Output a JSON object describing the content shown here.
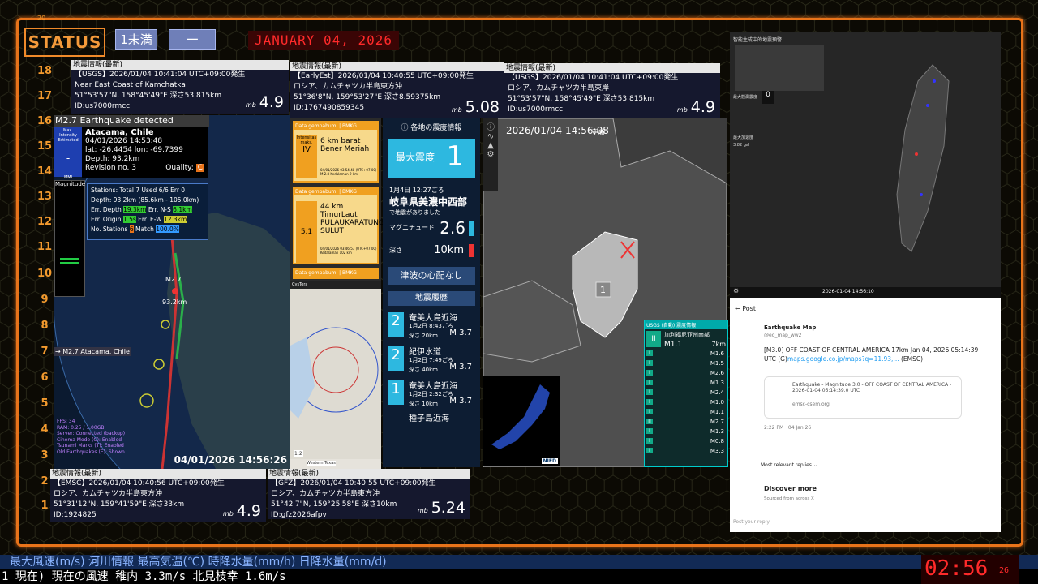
{
  "header": {
    "status_label": "STATUS",
    "tag1": "1未満",
    "tag2": "一",
    "date_led": "JANUARY 04, 2026",
    "corner_num": "20"
  },
  "scale_numbers": [
    "18",
    "17",
    "16",
    "15",
    "14",
    "13",
    "12",
    "11",
    "10",
    "9",
    "8",
    "7",
    "6",
    "5",
    "4",
    "3",
    "2",
    "1"
  ],
  "cards": {
    "c1": {
      "header": "地震情報(最新)",
      "line1": "【USGS】2026/01/04 10:41:04 UTC+09:00発生",
      "line2": "Near East Coast of Kamchatka",
      "line3": "51°53'57\"N, 158°45'49\"E 深さ53.815km",
      "line4": "ID:us7000rmcc",
      "mb": "mb",
      "mag": "4.9"
    },
    "c2": {
      "header": "地震情報(最新)",
      "line1": "【EarlyEst】2026/01/04 10:40:55 UTC+09:00発生",
      "line2": "ロシア、カムチャツカ半島東方沖",
      "line3": "51°36'8\"N, 159°53'27\"E 深さ8.59375km",
      "line4": "ID:1767490859345",
      "mb": "mb",
      "mag": "5.08"
    },
    "c3": {
      "header": "地震情報(最新)",
      "line1": "【USGS】2026/01/04 10:41:04 UTC+09:00発生",
      "line2": "ロシア、カムチャツカ半島東岸",
      "line3": "51°53'57\"N, 158°45'49\"E 深さ53.815km",
      "line4": "ID:us7000rmcc",
      "mb": "mb",
      "mag": "4.9"
    },
    "c4": {
      "header": "地震情報(最新)",
      "line1": "【EMSC】2026/01/04 10:40:56 UTC+09:00発生",
      "line2": "ロシア、カムチャツカ半島東方沖",
      "line3": "51°31'12\"N, 159°41'59\"E 深さ33km",
      "line4": "ID:1924825",
      "mb": "mb",
      "mag": "4.9"
    },
    "c5": {
      "header": "地震情報(最新)",
      "line1": "【GFZ】2026/01/04 10:40:55 UTC+09:00発生",
      "line2": "ロシア、カムチャツカ半島東方沖",
      "line3": "51°42'7\"N, 159°25'58\"E 深さ10km",
      "line4": "ID:gfz2026afpv",
      "mb": "mb",
      "mag": "5.24"
    }
  },
  "chile": {
    "title": "M2.7 Earthquake detected",
    "intensity_label": "Max. Intensity Estimated",
    "intensity_value": "-",
    "intensity_unit": "MMI",
    "place": "Atacama, Chile",
    "time": "04/01/2026 14:53:48",
    "latlon": "lat: -26.4454 lon: -69.7399",
    "depth": "Depth: 93.2km",
    "revision": "Revision no. 3",
    "quality_label": "Quality:",
    "quality_value": "C",
    "magnitude_label": "Magnitude",
    "stations": "Stations: Total 7 Used 6/6 Err 0",
    "depth_range": "Depth: 93.2km (85.6km - 105.0km)",
    "err_depth_label": "Err. Depth",
    "err_depth": "19.3km",
    "err_ns_label": "Err. N-S",
    "err_ns": "6.1km",
    "err_origin_label": "Err. Origin",
    "err_origin": "1.5s",
    "err_ew_label": "Err. E-W",
    "err_ew": "12.3km",
    "nst_label": "No. Stations",
    "nst": "6",
    "match_label": "Match",
    "match": "100.0%",
    "map_mag": "M2.7",
    "map_depth": "93.2km",
    "side_label": "→ M2.7 Atacama, Chile",
    "fps": "FPS: 34",
    "ram": "RAM: 0.25 / 1.00GB",
    "server": "Server: Connected (backup)",
    "cinema": "Cinema Mode (C): Enabled",
    "tsunami": "Tsunami Marks (T): Enabled",
    "old_eq": "Old Earthquakes (E): Shown",
    "timestamp": "04/01/2026 14:56:26"
  },
  "bmkg": {
    "header": "Data gempabumi | BMKG",
    "q1_int": "IV",
    "q1_int_label": "Intensitas maks.",
    "q1_place": "6 km barat Bener Meriah",
    "q1_meta": "04/01/2026 03:54:48 (UTC+07:00)  M 2.8  Kedalaman 9 km",
    "q2_mag": "5.1",
    "q2_place": "44 km TimurLaut PULAUKARATUNG-SULUT",
    "q2_meta": "04/01/2026 03:46:57 (UTC+07:00)  Kedalaman 102 km"
  },
  "leaflet": {
    "title": "CysTora",
    "place": "Western Texas",
    "scale": "1:2"
  },
  "japan": {
    "section_title": "各地の震度情報",
    "max_label": "最大震度",
    "max_value": "1",
    "date": "1月4日 12:27ごろ",
    "region": "岐阜県美濃中西部",
    "region_suffix": "で地震がありました",
    "mag_label": "マグニチュード",
    "mag_value": "2.6",
    "depth_label": "深さ",
    "depth_value": "10km",
    "tsunami": "津波の心配なし",
    "history_title": "地震履歴",
    "history": [
      {
        "int": "2",
        "place": "奄美大島近海",
        "date": "1月2日 8:43ごろ",
        "depth": "深さ 20km",
        "mag": "M 3.7"
      },
      {
        "int": "2",
        "place": "紀伊水道",
        "date": "1月2日 7:49ごろ",
        "depth": "深さ 40km",
        "mag": "M 3.7"
      },
      {
        "int": "1",
        "place": "奄美大島近海",
        "date": "1月2日 2:32ごろ",
        "depth": "深さ 10km",
        "mag": "M 3.7"
      },
      {
        "int": "",
        "place": "種子島近海",
        "date": "",
        "depth": "",
        "mag": ""
      }
    ],
    "map_time": "2026/01/04 14:56:08",
    "map_update": "更新",
    "map_marker": "1"
  },
  "usgs_list": {
    "title": "USGS (自動) 震度情報",
    "top_int": "II",
    "top_place": "加利福尼亚州南部",
    "top_mag": "M1.1",
    "top_depth": "7km",
    "items": [
      {
        "int": "I",
        "mag": "M1.6"
      },
      {
        "int": "I",
        "mag": "M1.5"
      },
      {
        "int": "I",
        "mag": "M2.6"
      },
      {
        "int": "I",
        "mag": "M1.3"
      },
      {
        "int": "I",
        "mag": "M2.4"
      },
      {
        "int": "I",
        "mag": "M1.0"
      },
      {
        "int": "I",
        "mag": "M1.1"
      },
      {
        "int": "II",
        "mag": "M2.7"
      },
      {
        "int": "I",
        "mag": "M1.3"
      },
      {
        "int": "I",
        "mag": "M0.8"
      },
      {
        "int": "I",
        "mag": "M3.3"
      }
    ]
  },
  "nied_label": "NIED",
  "taiwan": {
    "panel_title": "智能生成中的地震預警",
    "max_label": "最大觀測震度",
    "count_value": "0",
    "pga_label": "最大加速度",
    "pga_value": "3.82 gal",
    "time": "2026-01-04 14:56:10"
  },
  "post": {
    "title": "Post",
    "author": "Earthquake Map",
    "handle": "@eq_map_ww2",
    "body": "[M3.0] OFF COAST OF CENTRAL AMERICA 17km Jan 04, 2026 05:14:39 UTC (G)",
    "link_text": "maps.google.co.jp/maps?q=11.93,...",
    "body_tail": " (EMSC)",
    "embed_title": "Earthquake - Magnitude 3.0 - OFF COAST OF CENTRAL AMERICA - 2026-01-04 05:14:39.0 UTC",
    "embed_domain": "emsc-csem.org",
    "timestamp": "2:22 PM · 04 Jan 26",
    "replies_label": "Most relevant replies",
    "discover_title": "Discover more",
    "discover_sub": "Sourced from across X",
    "reply_placeholder": "Post your reply"
  },
  "ticker": {
    "line1": "最大風速(m/s)  河川情報    最高気温(℃)    時降水量(mm/h)   日降水量(mm/d)",
    "line2": "1 現在)  現在の風速      稚内 3.3m/s     北見枝幸 1.6m/s",
    "clock": "02:56",
    "clock_sec": "26"
  },
  "colors": {
    "frame": "#e8731a",
    "accent": "#f39a2e",
    "tag": "#6f7fb8",
    "led": "#ff2a2a"
  }
}
